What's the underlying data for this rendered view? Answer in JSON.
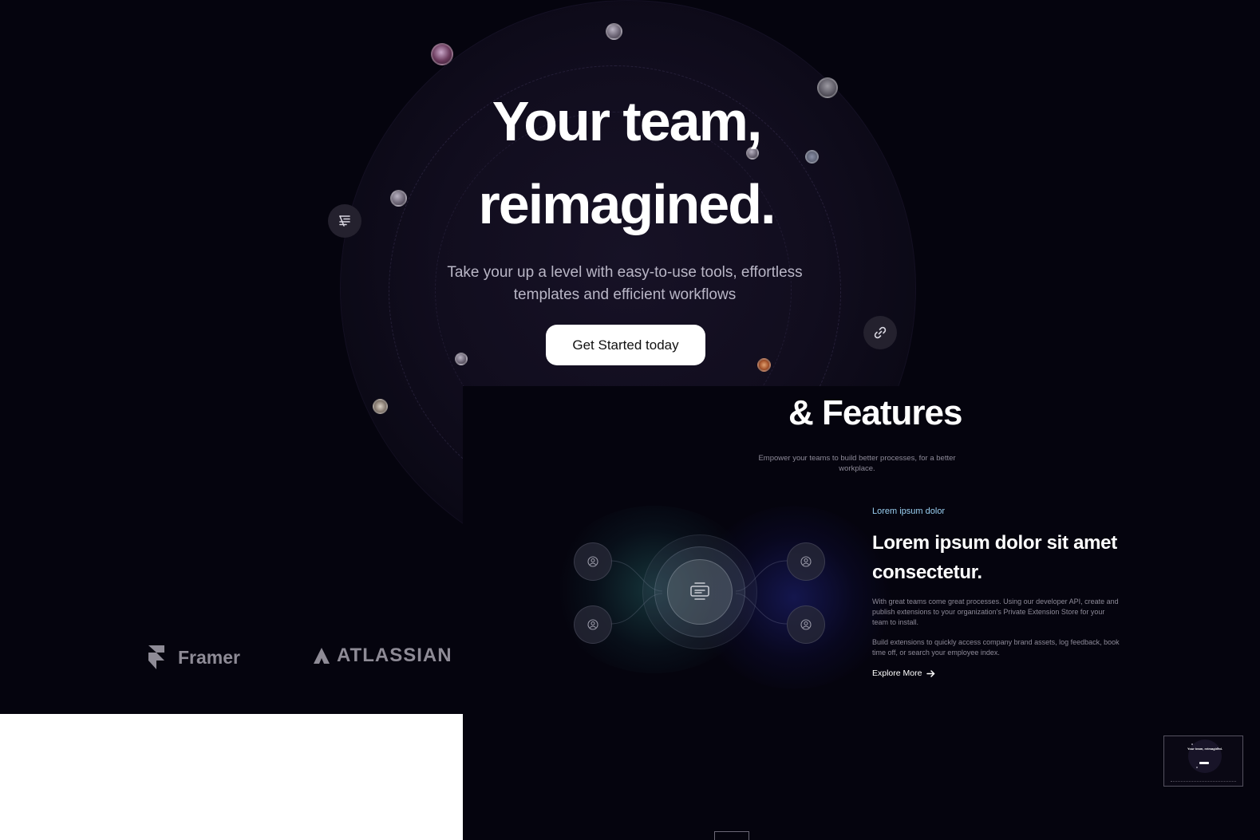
{
  "hero": {
    "title_line1": "Your team,",
    "title_line2": "reimagined.",
    "subtitle": "Take your up a level with easy-to-use tools, effortless templates and efficient workflows",
    "cta_label": "Get Started today"
  },
  "logos": {
    "items": [
      {
        "name": "Framer",
        "icon": "framer-icon"
      },
      {
        "name": "ATLASSIAN",
        "icon": "atlassian-icon"
      }
    ]
  },
  "features": {
    "title": "& Features",
    "subtitle": "Empower your teams to build better processes, for a better workplace.",
    "eyebrow": "Lorem ipsum dolor",
    "heading": "Lorem ipsum dolor sit amet consectetur.",
    "body_1": "With great teams come great processes. Using our developer API, create and publish extensions to your organization's Private Extension Store for your team to install.",
    "body_2": "Build extensions to quickly access company brand assets, log feedback, book time off, or search your employee index.",
    "explore_label": "Explore More"
  },
  "thumbnail": {
    "title": "Your team, reimagined."
  },
  "colors": {
    "background": "#05040e",
    "eyebrow": "#9ad0f2",
    "body_text": "#8d8a98",
    "cta_bg": "#ffffff"
  }
}
